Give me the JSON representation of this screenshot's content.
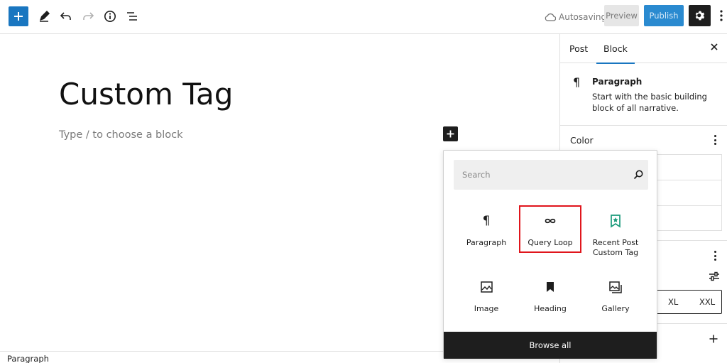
{
  "toolbar": {
    "inserter_icon": "plus-icon",
    "autosave_label": "Autosaving",
    "preview_label": "Preview",
    "publish_label": "Publish"
  },
  "editor": {
    "title": "Custom Tag",
    "placeholder": "Type / to choose a block"
  },
  "footer": {
    "breadcrumb": "Paragraph"
  },
  "sidebar": {
    "tabs": [
      {
        "label": "Post"
      },
      {
        "label": "Block"
      }
    ],
    "active_tab": "Block",
    "block_card": {
      "title": "Paragraph",
      "description": "Start with the basic building block of all narrative."
    },
    "color_panel": {
      "title": "Color"
    },
    "size_options": [
      "XL",
      "XXL"
    ]
  },
  "inserter_popover": {
    "search_placeholder": "Search",
    "blocks": [
      {
        "label": "Paragraph",
        "icon": "paragraph-icon"
      },
      {
        "label": "Query Loop",
        "icon": "query-loop-icon",
        "highlighted": true
      },
      {
        "label": "Recent Post Custom Tag",
        "label_lines": [
          "Recent Post",
          "Custom Tag"
        ],
        "icon": "bookmark-star-icon"
      },
      {
        "label": "Image",
        "icon": "image-icon"
      },
      {
        "label": "Heading",
        "icon": "heading-bookmark-icon"
      },
      {
        "label": "Gallery",
        "icon": "gallery-icon"
      }
    ],
    "browse_all_label": "Browse all"
  },
  "colors": {
    "primary": "#1976c0",
    "publish": "#2a8ad0",
    "dark": "#1e1e1e",
    "highlight": "#e0151c",
    "teal_icon": "#1a9a7a"
  }
}
